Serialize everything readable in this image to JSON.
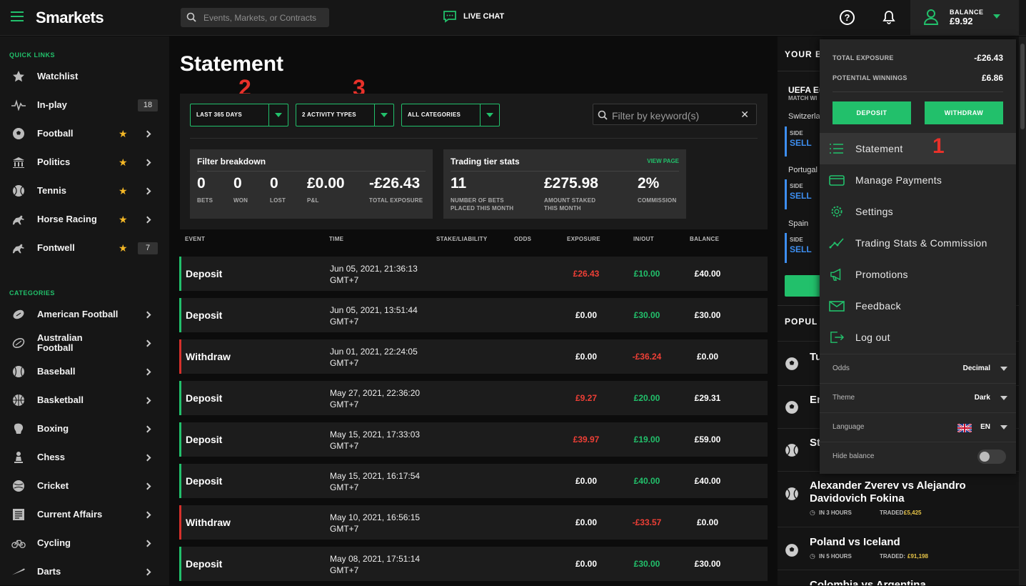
{
  "header": {
    "logo": "Smarkets",
    "search_placeholder": "Events, Markets, or Contracts",
    "live_chat": "LIVE CHAT",
    "balance_label": "BALANCE",
    "balance_value": "£9.92"
  },
  "sidebar": {
    "quick_links_label": "QUICK LINKS",
    "quick_links": [
      {
        "label": "Watchlist",
        "icon": "star-icon"
      },
      {
        "label": "In-play",
        "icon": "pulse-icon",
        "badge": "18"
      },
      {
        "label": "Football",
        "icon": "football-icon",
        "starred": true
      },
      {
        "label": "Politics",
        "icon": "government-icon",
        "starred": true
      },
      {
        "label": "Tennis",
        "icon": "tennis-icon",
        "starred": true
      },
      {
        "label": "Horse Racing",
        "icon": "horse-icon",
        "starred": true
      },
      {
        "label": "Fontwell",
        "icon": "horse-icon",
        "starred": true,
        "badge": "7"
      }
    ],
    "categories_label": "CATEGORIES",
    "categories": [
      {
        "label": "American Football",
        "icon": "american-football-icon"
      },
      {
        "label": "Australian Football",
        "icon": "australian-football-icon"
      },
      {
        "label": "Baseball",
        "icon": "baseball-icon"
      },
      {
        "label": "Basketball",
        "icon": "basketball-icon"
      },
      {
        "label": "Boxing",
        "icon": "boxing-glove-icon"
      },
      {
        "label": "Chess",
        "icon": "chess-icon"
      },
      {
        "label": "Cricket",
        "icon": "cricket-icon"
      },
      {
        "label": "Current Affairs",
        "icon": "newspaper-icon"
      },
      {
        "label": "Cycling",
        "icon": "bicycle-icon"
      },
      {
        "label": "Darts",
        "icon": "dart-icon"
      }
    ]
  },
  "main": {
    "title": "Statement",
    "annotations": [
      "2",
      "3",
      "1"
    ],
    "filters": {
      "period": "LAST 365 DAYS",
      "activity": "2 ACTIVITY TYPES",
      "categories": "ALL CATEGORIES",
      "keyword_placeholder": "Filter by keyword(s)"
    },
    "filter_breakdown": {
      "title": "Filter breakdown",
      "stats": [
        {
          "value": "0",
          "label": "BETS"
        },
        {
          "value": "0",
          "label": "WON"
        },
        {
          "value": "0",
          "label": "LOST"
        },
        {
          "value": "£0.00",
          "label": "P&L"
        },
        {
          "value": "-£26.43",
          "label": "TOTAL EXPOSURE"
        }
      ]
    },
    "trading_tier": {
      "title": "Trading tier stats",
      "link": "VIEW PAGE",
      "stats": [
        {
          "value": "11",
          "label": "NUMBER OF BETS PLACED THIS MONTH"
        },
        {
          "value": "£275.98",
          "label": "AMOUNT STAKED THIS MONTH"
        },
        {
          "value": "2%",
          "label": "COMMISSION"
        }
      ]
    },
    "columns": [
      "EVENT",
      "TIME",
      "STAKE/LIABILITY",
      "ODDS",
      "EXPOSURE",
      "IN/OUT",
      "BALANCE"
    ],
    "rows": [
      {
        "event": "Deposit",
        "date": "Jun 05, 2021, 21:36:13",
        "tz": "GMT+7",
        "exposure": "£26.43",
        "exposure_red": true,
        "inout": "£10.00",
        "inout_neg": false,
        "balance": "£40.00"
      },
      {
        "event": "Deposit",
        "date": "Jun 05, 2021, 13:51:44",
        "tz": "GMT+7",
        "exposure": "£0.00",
        "exposure_red": false,
        "inout": "£30.00",
        "inout_neg": false,
        "balance": "£30.00"
      },
      {
        "event": "Withdraw",
        "date": "Jun 01, 2021, 22:24:05",
        "tz": "GMT+7",
        "exposure": "£0.00",
        "exposure_red": false,
        "inout": "-£36.24",
        "inout_neg": true,
        "balance": "£0.00"
      },
      {
        "event": "Deposit",
        "date": "May 27, 2021, 22:36:20",
        "tz": "GMT+7",
        "exposure": "£9.27",
        "exposure_red": true,
        "inout": "£20.00",
        "inout_neg": false,
        "balance": "£29.31"
      },
      {
        "event": "Deposit",
        "date": "May 15, 2021, 17:33:03",
        "tz": "GMT+7",
        "exposure": "£39.97",
        "exposure_red": true,
        "inout": "£19.00",
        "inout_neg": false,
        "balance": "£59.00"
      },
      {
        "event": "Deposit",
        "date": "May 15, 2021, 16:17:54",
        "tz": "GMT+7",
        "exposure": "£0.00",
        "exposure_red": false,
        "inout": "£40.00",
        "inout_neg": false,
        "balance": "£40.00"
      },
      {
        "event": "Withdraw",
        "date": "May 10, 2021, 16:56:15",
        "tz": "GMT+7",
        "exposure": "£0.00",
        "exposure_red": false,
        "inout": "-£33.57",
        "inout_neg": true,
        "balance": "£0.00"
      },
      {
        "event": "Deposit",
        "date": "May 08, 2021, 17:51:14",
        "tz": "GMT+7",
        "exposure": "£0.00",
        "exposure_red": false,
        "inout": "£30.00",
        "inout_neg": false,
        "balance": "£30.00"
      }
    ]
  },
  "right": {
    "your_bets": "YOUR B",
    "event1": "UEFA Eu",
    "event1_sub": "MATCH WI",
    "sel1": "Switzerla",
    "side": "SIDE",
    "sell": "SELL",
    "sel2": "Portugal",
    "sel3": "Spain",
    "popular": "POPUL",
    "pop_items": [
      {
        "title": "Tu"
      },
      {
        "title": "Er"
      },
      {
        "title": "St"
      }
    ],
    "match1": {
      "title": "Alexander Zverev vs Alejandro Davidovich Fokina",
      "time": "IN 3 HOURS",
      "traded_label": "TRADED:",
      "traded": "£5,425"
    },
    "match2": {
      "title": "Poland vs Iceland",
      "time": "IN 5 HOURS",
      "traded_label": "TRADED:",
      "traded": "£91,198"
    },
    "match3": {
      "title": "Colombia vs Argentina"
    }
  },
  "account_menu": {
    "total_exposure_label": "TOTAL EXPOSURE",
    "total_exposure": "-£26.43",
    "potential_winnings_label": "POTENTIAL WINNINGS",
    "potential_winnings": "£6.86",
    "deposit": "DEPOSIT",
    "withdraw": "WITHDRAW",
    "items": [
      "Statement",
      "Manage Payments",
      "Settings",
      "Trading Stats & Commission",
      "Promotions",
      "Feedback",
      "Log out"
    ],
    "odds_label": "Odds",
    "odds_value": "Decimal",
    "theme_label": "Theme",
    "theme_value": "Dark",
    "language_label": "Language",
    "language_value": "EN",
    "hide_balance_label": "Hide balance"
  },
  "colors": {
    "accent": "#22c06b",
    "negative": "#ee3f36",
    "star": "#f5b826"
  }
}
